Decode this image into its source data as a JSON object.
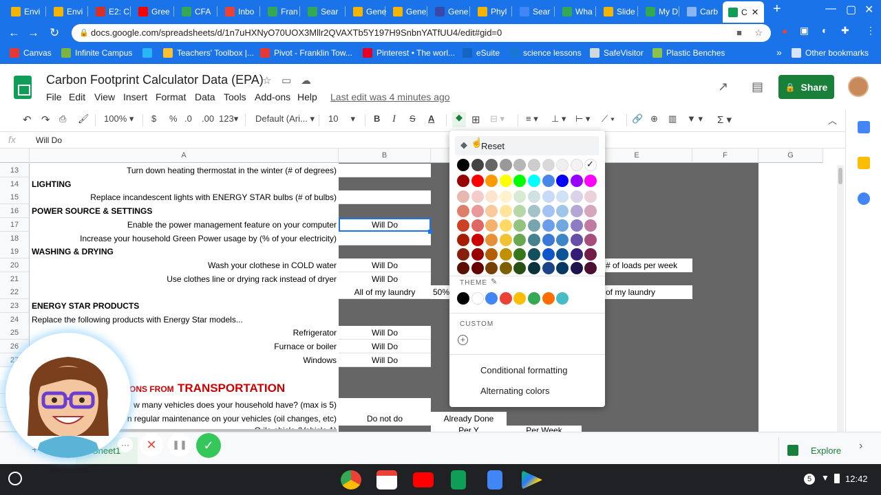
{
  "browser": {
    "tabs": [
      {
        "label": "Envi",
        "fav_color": "#f4b400"
      },
      {
        "label": "Envi",
        "fav_color": "#f4b400"
      },
      {
        "label": "E2: C",
        "fav_color": "#d93025"
      },
      {
        "label": "Gree",
        "fav_color": "#ff0000"
      },
      {
        "label": "CFA",
        "fav_color": "#34a853"
      },
      {
        "label": "Inbo",
        "fav_color": "#ea4335"
      },
      {
        "label": "Fran",
        "fav_color": "#34a853"
      },
      {
        "label": "Sear",
        "fav_color": "#34a853"
      },
      {
        "label": "Gene",
        "fav_color": "#f4b400"
      },
      {
        "label": "Gene",
        "fav_color": "#f4b400"
      },
      {
        "label": "Gene",
        "fav_color": "#3949ab"
      },
      {
        "label": "Phyl",
        "fav_color": "#f4b400"
      },
      {
        "label": "Sear",
        "fav_color": "#4285f4"
      },
      {
        "label": "Wha",
        "fav_color": "#34a853"
      },
      {
        "label": "Slide",
        "fav_color": "#f4b400"
      },
      {
        "label": "My D",
        "fav_color": "#34a853"
      },
      {
        "label": "Carb",
        "fav_color": "#8ab4f8"
      }
    ],
    "active_tab": {
      "label": "C",
      "close": "✕"
    },
    "new_tab": "+",
    "url": "docs.google.com/spreadsheets/d/1n7uHXNyO70UOX3Mllr2QVAXTb5Y197H9SnbnYATfUU4/edit#gid=0",
    "bookmarks": [
      {
        "label": "Canvas",
        "fav_color": "#e53935"
      },
      {
        "label": "Infinite Campus",
        "fav_color": "#7cb342"
      },
      {
        "label": "",
        "fav_color": "#29b6f6"
      },
      {
        "label": "Teachers' Toolbox |...",
        "fav_color": "#fbc02d"
      },
      {
        "label": "Pivot - Franklin Tow...",
        "fav_color": "#e53935"
      },
      {
        "label": "Pinterest • The worl...",
        "fav_color": "#e60023"
      },
      {
        "label": "eSuite",
        "fav_color": "#1565c0"
      },
      {
        "label": "science lessons",
        "fav_color": "#1976d2"
      },
      {
        "label": "SafeVisitor",
        "fav_color": "#cfd8dc"
      },
      {
        "label": "Plastic Benches",
        "fav_color": "#8bc34a"
      }
    ],
    "bookmarks_more": "»",
    "other_bookmarks": "Other bookmarks"
  },
  "sheets": {
    "title": "Carbon Footprint Calculator Data (EPA)",
    "menus": [
      "File",
      "Edit",
      "View",
      "Insert",
      "Format",
      "Data",
      "Tools",
      "Add-ons",
      "Help"
    ],
    "last_edit": "Last edit was 4 minutes ago",
    "share_label": "Share",
    "toolbar": {
      "zoom": "100%",
      "currency": "$",
      "percent": "%",
      "dec_less": ".0",
      "dec_more": ".00",
      "more_formats": "123",
      "font": "Default (Ari...",
      "font_size": "10"
    },
    "formula": {
      "fx": "fx",
      "value": "Will Do"
    },
    "columns": [
      "A",
      "B",
      "C",
      "D",
      "E",
      "F",
      "G"
    ],
    "rows": [
      {
        "num": "13",
        "a": "Turn down heating thermostat in the winter (# of degrees)",
        "a_align": "r"
      },
      {
        "num": "14",
        "a": "LIGHTING",
        "a_align": "b"
      },
      {
        "num": "15",
        "a": "Replace incandescent lights with ENERGY STAR bulbs (# of bulbs)",
        "a_align": "r"
      },
      {
        "num": "16",
        "a": "POWER SOURCE & SETTINGS",
        "a_align": "b"
      },
      {
        "num": "17",
        "a": "Enable the power management feature on your computer",
        "a_align": "r",
        "b": "Will Do"
      },
      {
        "num": "18",
        "a": "Increase your household Green Power usage by (% of your electricity)",
        "a_align": "r"
      },
      {
        "num": "19",
        "a": "WASHING & DRYING",
        "a_align": "b"
      },
      {
        "num": "20",
        "a": "Wash your clothese in COLD water",
        "a_align": "r",
        "b": "Will Do",
        "e": "# of loads per week"
      },
      {
        "num": "21",
        "a": "Use clothes line or drying rack instead of dryer",
        "a_align": "r",
        "b": "Will Do"
      },
      {
        "num": "22",
        "a": "",
        "a_align": "r",
        "b": "All of my laundry",
        "c": "50%",
        "e": "of my laundry"
      },
      {
        "num": "23",
        "a": "ENERGY STAR PRODUCTS",
        "a_align": "b"
      },
      {
        "num": "24",
        "a": "Replace the following products with Energy Star models...",
        "a_align": "l"
      },
      {
        "num": "25",
        "a": "Refrigerator",
        "a_align": "r",
        "b": "Will Do"
      },
      {
        "num": "26",
        "a": "Furnace or boiler",
        "a_align": "r",
        "b": "Will Do"
      },
      {
        "num": "27",
        "a": "Windows",
        "a_align": "r",
        "b": "Will Do"
      }
    ],
    "lower_rows": {
      "transport_prefix": "ONS FROM",
      "transport_word": "TRANSPORTATION",
      "vehicles": "w many vehicles does your household have? (max is 5)",
      "maintenance": "n regular maintenance on your vehicles (oil changes, etc)",
      "maint_b": "Do not do",
      "maint_c": "Already Done",
      "cut_a": "O                                    ile     ehicle (Vehicle 1)",
      "cut_c": "Per Y",
      "cut_d": "Per Week"
    },
    "sheet_tab": "Sheet1",
    "explore_label": "Explore"
  },
  "color_picker": {
    "reset_label": "Reset",
    "grayscale": [
      "#000000",
      "#434343",
      "#666666",
      "#999999",
      "#b7b7b7",
      "#cccccc",
      "#d9d9d9",
      "#efefef",
      "#f3f3f3",
      "#ffffff"
    ],
    "bright": [
      "#980000",
      "#ff0000",
      "#ff9900",
      "#ffff00",
      "#00ff00",
      "#00ffff",
      "#4a86e8",
      "#0000ff",
      "#9900ff",
      "#ff00ff"
    ],
    "tints": [
      [
        "#e6b8af",
        "#f4cccc",
        "#fce5cd",
        "#fff2cc",
        "#d9ead3",
        "#d0e0e3",
        "#c9daf8",
        "#cfe2f3",
        "#d9d2e9",
        "#ead1dc"
      ],
      [
        "#dd7e6b",
        "#ea9999",
        "#f9cb9c",
        "#ffe599",
        "#b6d7a8",
        "#a2c4c9",
        "#a4c2f4",
        "#9fc5e8",
        "#b4a7d6",
        "#d5a6bd"
      ],
      [
        "#cc4125",
        "#e06666",
        "#f6b26b",
        "#ffd966",
        "#93c47d",
        "#76a5af",
        "#6d9eeb",
        "#6fa8dc",
        "#8e7cc3",
        "#c27ba0"
      ],
      [
        "#a61c00",
        "#cc0000",
        "#e69138",
        "#f1c232",
        "#6aa84f",
        "#45818e",
        "#3c78d8",
        "#3d85c6",
        "#674ea7",
        "#a64d79"
      ],
      [
        "#85200c",
        "#990000",
        "#b45f06",
        "#bf9000",
        "#38761d",
        "#134f5c",
        "#1155cc",
        "#0b5394",
        "#351c75",
        "#741b47"
      ],
      [
        "#5b0f00",
        "#660000",
        "#783f04",
        "#7f6000",
        "#274e13",
        "#0c343d",
        "#1c4587",
        "#073763",
        "#20124d",
        "#4c1130"
      ]
    ],
    "theme_label": "THEME",
    "theme": [
      "#000000",
      "#ffffff",
      "#4285f4",
      "#ea4335",
      "#fbbc04",
      "#34a853",
      "#ff6d01",
      "#46bdc6"
    ],
    "custom_label": "CUSTOM",
    "add_custom": "+",
    "conditional": "Conditional formatting",
    "alternating": "Alternating colors"
  },
  "recorder": {
    "more": "···",
    "cancel": "✕",
    "pause": "❚❚",
    "done": "✓"
  },
  "system": {
    "time": "12:42",
    "badge": "5"
  }
}
